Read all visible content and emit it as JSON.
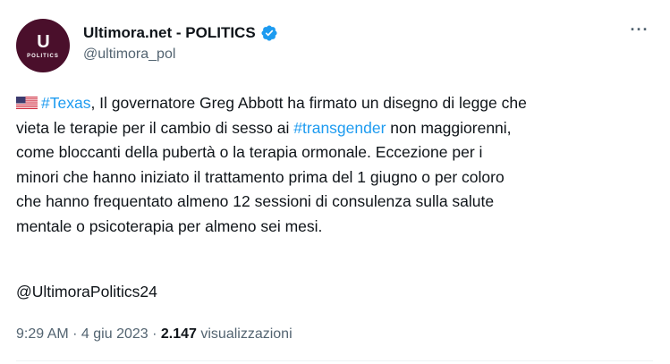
{
  "author": {
    "display_name": "Ultimora.net - POLITICS",
    "handle": "@ultimora_pol",
    "avatar_mark": "U",
    "avatar_sub": "POLITICS",
    "avatar_color": "#4a0f2b",
    "verified": true,
    "verified_color": "#1d9bf0"
  },
  "more_menu": "···",
  "tweet": {
    "line1_pre": "",
    "hashtag_texas": "#Texas",
    "line1_post": ", Il governatore Greg Abbott ha firmato un disegno di legge che",
    "line2_pre": "vieta le terapie per il cambio di sesso ai ",
    "hashtag_transgender": "#transgender",
    "line2_post": " non maggiorenni,",
    "line3": "come bloccanti della pubertà o la terapia ormonale. Eccezione per i",
    "line4": "minori che hanno iniziato il trattamento prima del 1 giugno o per coloro",
    "line5": "che hanno frequentato almeno 12 sessioni di consulenza sulla salute",
    "line6": "mentale o psicoterapia per almeno sei mesi.",
    "signature": "@UltimoraPolitics24",
    "flag_icon": "us-flag-icon"
  },
  "meta": {
    "time": "9:29 AM",
    "separator": " · ",
    "date": "4 giu 2023",
    "views_count": "2.147",
    "views_label": " visualizzazioni"
  },
  "colors": {
    "hashtag": "#1d9bf0",
    "text": "#0f1419",
    "secondary": "#536471"
  }
}
